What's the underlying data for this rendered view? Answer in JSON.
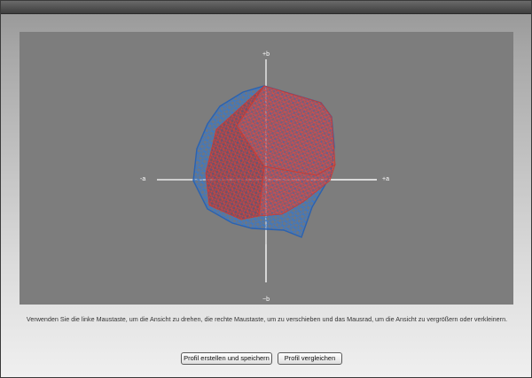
{
  "viewer": {
    "axis_labels": {
      "plus_b": "+b",
      "minus_b": "−b",
      "minus_a": "-a",
      "plus_a": "+a"
    },
    "colors": {
      "background": "#7d7d7d",
      "mesh_red": "#c83a35",
      "mesh_blue": "#2c5fa5",
      "axis": "#ffffff"
    }
  },
  "instructions": "Verwenden Sie die linke Maustaste, um die Ansicht zu drehen, die rechte Maustaste, um zu verschieben und das Mausrad, um die Ansicht zu vergrößern oder verkleinern.",
  "buttons": {
    "create_save": "Profil erstellen und speichern",
    "compare": "Profil vergleichen"
  }
}
